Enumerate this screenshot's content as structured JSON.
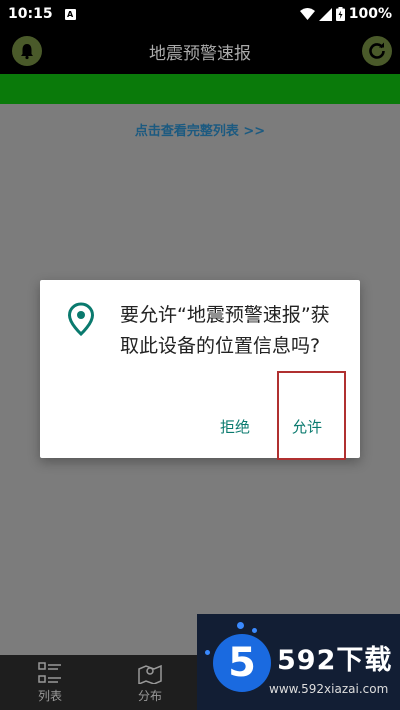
{
  "status_bar": {
    "time": "10:15",
    "notification_badge": "A",
    "battery": "100%"
  },
  "header": {
    "title": "地震预警速报",
    "left_icon": "bell-icon",
    "right_icon": "refresh-icon"
  },
  "content": {
    "view_all_link": "点击查看完整列表 >>"
  },
  "dialog": {
    "icon": "location-pin-icon",
    "message": "要允许“地震预警速报”获取此设备的位置信息吗?",
    "deny_label": "拒绝",
    "allow_label": "允许"
  },
  "bottom_nav": {
    "items": [
      {
        "label": "列表",
        "icon": "list-icon"
      },
      {
        "label": "分布",
        "icon": "map-icon"
      }
    ]
  },
  "watermark": {
    "logo_char": "5",
    "brand": "592下载",
    "url": "www.592xiazai.com"
  },
  "colors": {
    "accent_green": "#0a7a0a",
    "dialog_button": "#0a7a6e",
    "link_blue": "#1c5a80",
    "highlight": "#b03030"
  }
}
